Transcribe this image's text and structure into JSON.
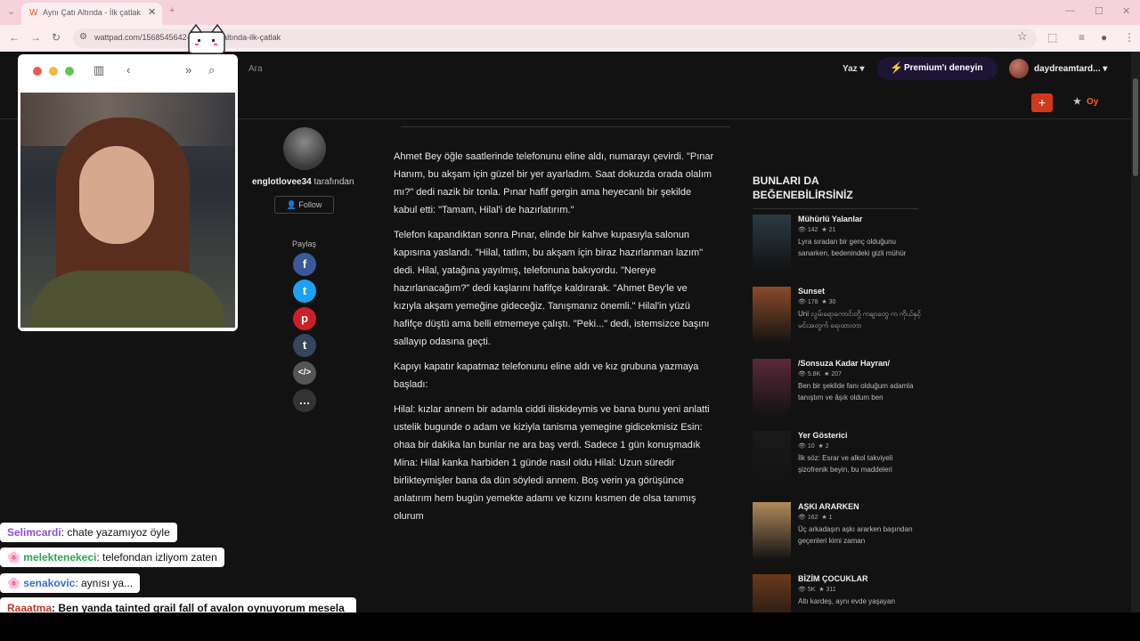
{
  "browser": {
    "tab_title": "Aynı Çatı Altında - İlk çatlak",
    "url": "wattpad.com/1568545642-aynı-çatı-altında-ilk-çatlak"
  },
  "site": {
    "search_placeholder": "Ara",
    "write_label": "Yaz",
    "premium_label": "Premium'ı deneyin",
    "username": "daydreamtard...",
    "vote_label": "Oy"
  },
  "author": {
    "name": "englotlovee34",
    "by_label": "tarafından",
    "follow_label": "Follow",
    "share_label": "Paylaş"
  },
  "story": {
    "paragraphs": [
      "Ahmet Bey öğle saatlerinde telefonunu eline aldı, numarayı çevirdi. \"Pınar Hanım, bu akşam için güzel bir yer ayarladım. Saat dokuzda orada olalım mı?\" dedi nazik bir tonla. Pınar hafif gergin ama heyecanlı bir şekilde kabul etti: \"Tamam, Hilal'i de hazırlatırım.\"",
      "Telefon kapandıktan sonra Pınar, elinde bir kahve kupasıyla salonun kapısına yaslandı. \"Hilal, tatlım, bu akşam için biraz hazırlanman lazım\" dedi. Hilal, yatağına yayılmış, telefonuna bakıyordu. \"Nereye hazırlanacağım?\" dedi kaşlarını hafifçe kaldırarak. \"Ahmet Bey'le ve kızıyla akşam yemeğine gideceğiz. Tanışmanız önemli.\" Hilal'in yüzü hafifçe düştü ama belli etmemeye çalıştı. \"Peki...\" dedi, istemsizce başını sallayıp odasına geçti.",
      "Kapıyı kapatır kapatmaz telefonunu eline aldı ve kız grubuna yazmaya başladı:",
      "Hilal: kızlar annem bir adamla ciddi iliskideymis ve bana bunu yeni anlatti ustelik bugunde o adam ve kiziyla tanisma yemegine gidicekmisiz Esin: ohaa bir dakika lan bunlar ne ara baş verdi. Sadece 1 gün konuşmadık Mina: Hilal kanka harbiden 1 günde nasıl oldu Hilal: Uzun süredir birlikteymişler bana da dün söyledi annem. Boş verin ya görüşünce anlatırım hem bugün yemekte adamı ve kızını kısmen de olsa tanımış olurum"
    ]
  },
  "recommendations": {
    "title": "BUNLARI DA BEĞENEBİLİRSİNİZ",
    "items": [
      {
        "title": "Mühürlü Yalanlar",
        "reads": "142",
        "votes": "21",
        "desc": "Lyra sıradan bir genç olduğunu sanarken, bedenindeki gizli mühür",
        "color": "#2a3a44"
      },
      {
        "title": "Sunset",
        "reads": "178",
        "votes": "30",
        "desc": "Uni လွမ်းရောကောင်းတို့ ကချာတွေ က ကိုယ်နှင့်မင်းအတွက် ရေးထားတာ",
        "color": "#8a4a2a"
      },
      {
        "title": "/Sonsuza Kadar Hayran/",
        "reads": "5.8K",
        "votes": "207",
        "desc": "Ben bir şekilde fanı olduğum adamla tanıştım ve âşık oldum ben",
        "color": "#5a2a3a"
      },
      {
        "title": "Yer Gösterici",
        "reads": "10",
        "votes": "2",
        "desc": "İlk söz: Esrar ve alkol takviyeli şizofrenik beyin, bu maddeleri",
        "color": "#1a1a1a"
      },
      {
        "title": "AŞKI ARARKEN",
        "reads": "162",
        "votes": "1",
        "desc": "Üç arkadaşın aşkı ararken başından geçenleri kimi zaman",
        "color": "#b08a5a"
      },
      {
        "title": "BİZİM ÇOCUKLAR",
        "reads": "5K",
        "votes": "311",
        "desc": "Altı kardeş, aynı evde yaşayan",
        "color": "#6a3a1a"
      }
    ]
  },
  "chat": [
    {
      "user": "Selimcardi",
      "message": ": chate yazamıyoz öyle",
      "color": "#8a4fd6"
    },
    {
      "user": "melektenekeci",
      "message": ": telefondan izliyom zaten",
      "color": "#2aa84a"
    },
    {
      "user": "senakovic",
      "message": ": aynısı ya...",
      "color": "#3a6ad6"
    },
    {
      "user": "Raaatma",
      "message": ": Ben yanda tainted grail fall of avalon oynuyorum mesela herkes bir oyun açsın yana",
      "color": "#c0392b"
    }
  ]
}
